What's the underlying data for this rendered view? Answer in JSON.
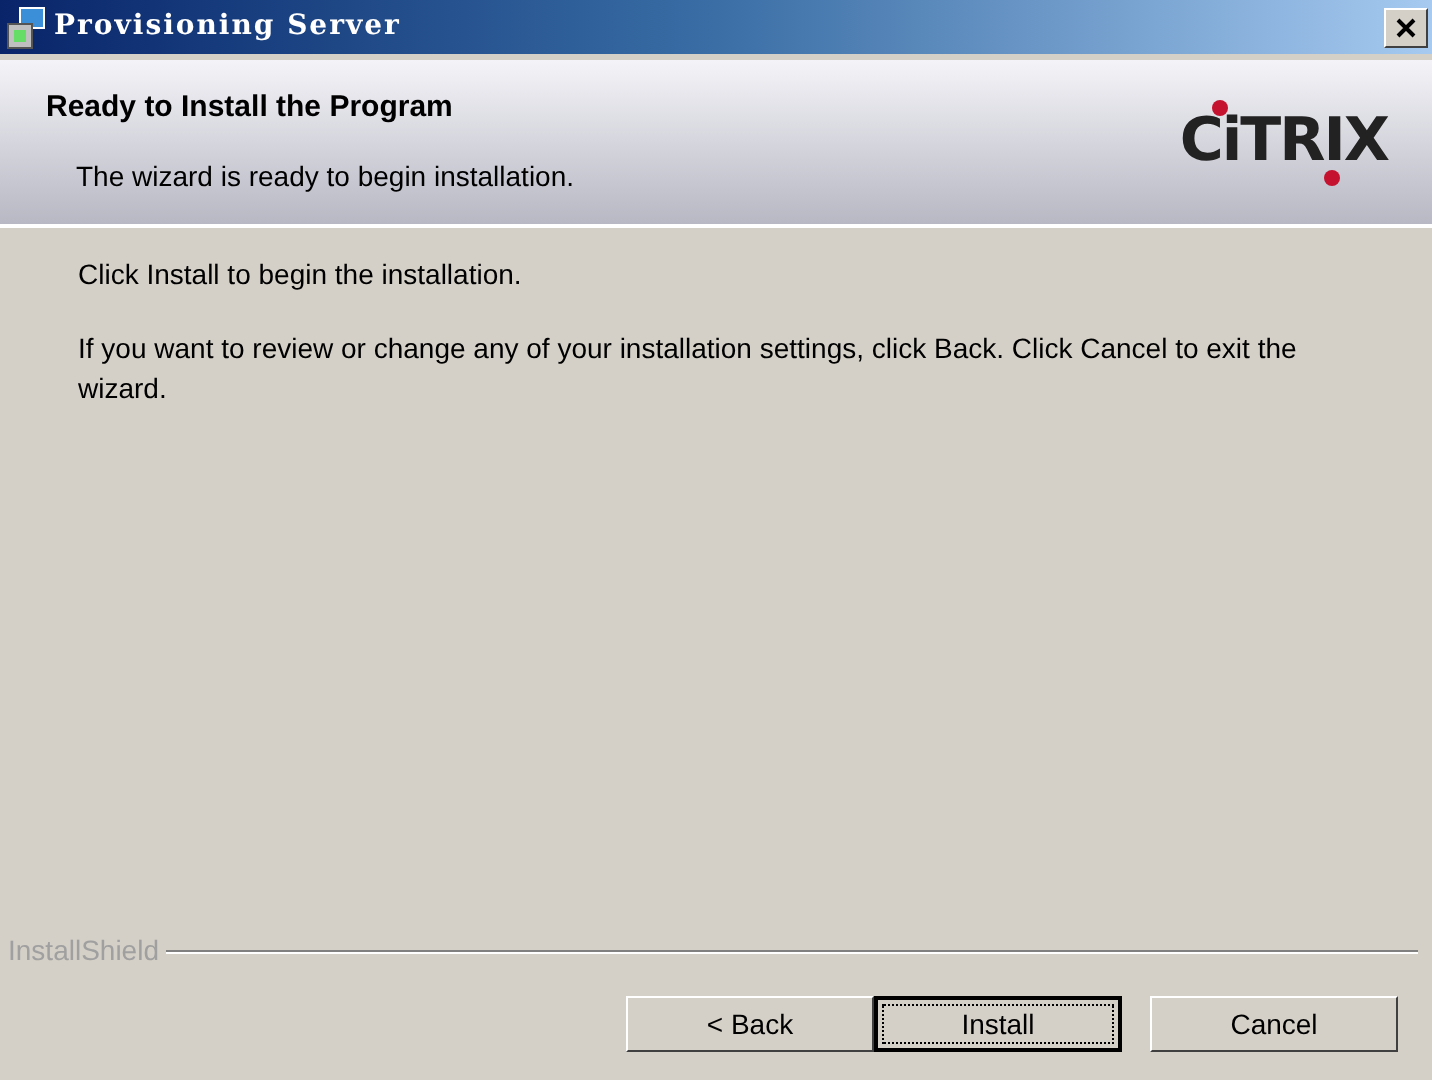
{
  "window": {
    "title": "Provisioning Server"
  },
  "header": {
    "title": "Ready to Install the Program",
    "subtitle": "The wizard is ready to begin installation.",
    "logo": "CiTRIX"
  },
  "body": [
    "Click Install to begin the installation.",
    "If you want to review or change any of your installation settings, click Back. Click Cancel to exit the wizard."
  ],
  "footer": {
    "brand": "InstallShield"
  },
  "buttons": [
    {
      "label": "< Back",
      "default": false
    },
    {
      "label": "Install",
      "default": true
    },
    {
      "label": "Cancel",
      "default": false
    }
  ]
}
